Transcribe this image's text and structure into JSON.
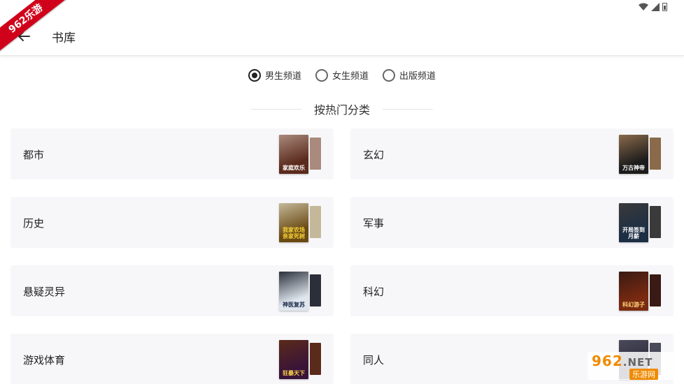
{
  "watermark": {
    "ribbon": "962乐游",
    "brand": "962",
    "brand_suffix": ".NET",
    "site": "乐游网"
  },
  "toolbar": {
    "title": "书库"
  },
  "channels": [
    {
      "label": "男生频道",
      "checked": true
    },
    {
      "label": "女生频道",
      "checked": false
    },
    {
      "label": "出版频道",
      "checked": false
    }
  ],
  "section": {
    "title": "按热门分类"
  },
  "categories": [
    {
      "label": "都市",
      "cover_text": "家庭欢乐",
      "cover_color": "#5a2a1c",
      "cover_color2": "#a98a7c",
      "text_color": "#ffffff"
    },
    {
      "label": "玄幻",
      "cover_text": "万古神帝",
      "cover_color": "#1b1b1b",
      "cover_color2": "#8a6a4a",
      "text_color": "#ffffff"
    },
    {
      "label": "历史",
      "cover_text": "我家农场亲家死树",
      "cover_color": "#6a4a12",
      "cover_color2": "#c4b89a",
      "text_color": "#f6d23a"
    },
    {
      "label": "军事",
      "cover_text": "开局签到月薪",
      "cover_color": "#1d2e44",
      "cover_color2": "#3a3a3a",
      "text_color": "#ffffff"
    },
    {
      "label": "悬疑灵异",
      "cover_text": "神医复苏",
      "cover_color": "#dfe6ee",
      "cover_color2": "#2a2f3a",
      "text_color": "#1c2a4a"
    },
    {
      "label": "科幻",
      "cover_text": "科幻游子",
      "cover_color": "#7a2a10",
      "cover_color2": "#3a1a14",
      "text_color": "#ffd27a"
    },
    {
      "label": "游戏体育",
      "cover_text": "狂暴天下",
      "cover_color": "#3a1438",
      "cover_color2": "#5a2a1a",
      "text_color": "#ffd84a"
    },
    {
      "label": "同人",
      "cover_text": "",
      "cover_color": "#2a2a3a",
      "cover_color2": "#4a4a5a",
      "text_color": "#ffffff"
    }
  ]
}
